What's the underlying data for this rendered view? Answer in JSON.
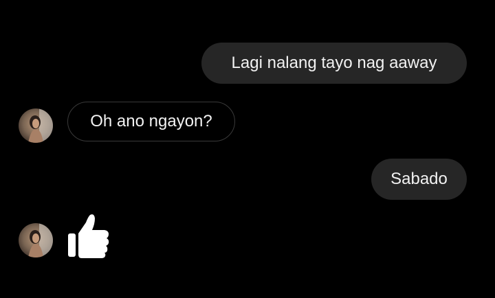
{
  "conversation": {
    "messages": [
      {
        "sender": "me",
        "text": "Lagi nalang tayo nag aaway"
      },
      {
        "sender": "them",
        "text": "Oh ano ngayon?"
      },
      {
        "sender": "me",
        "text": "Sabado"
      },
      {
        "sender": "them",
        "type": "reaction",
        "icon": "thumbs-up-icon"
      }
    ]
  },
  "colors": {
    "background": "#000000",
    "sent_bubble": "#262626",
    "received_border": "#3a3a3a",
    "text": "#f2f2f2"
  }
}
